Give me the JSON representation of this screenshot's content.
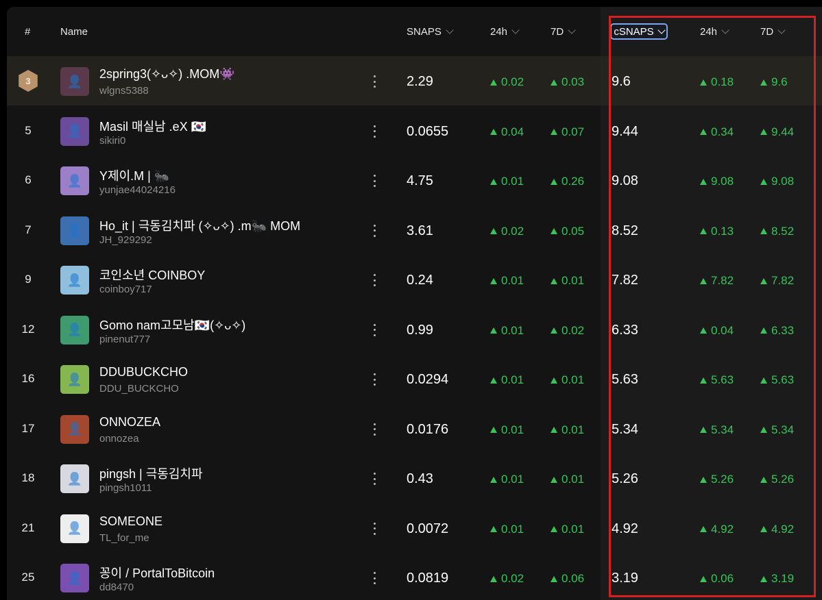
{
  "colors": {
    "up": "#3dc25b",
    "highlight_box": "#d4201f",
    "sort_outline": "#7fa4ea",
    "bronze": "#b8936c"
  },
  "header": {
    "rank": "#",
    "name": "Name",
    "snaps": "SNAPS",
    "snaps_24h": "24h",
    "snaps_7d": "7D",
    "csnaps": "cSNAPS",
    "csnaps_24h": "24h",
    "csnaps_7d": "7D"
  },
  "rows": [
    {
      "rank": "3",
      "badge": "bronze-medal",
      "name": "2spring3(✧ᴗ✧) .MOM👾",
      "handle": "wlgns5388",
      "snaps": "2.29",
      "s24h": "0.02",
      "s7d": "0.03",
      "csnaps": "9.6",
      "c24h": "0.18",
      "c7d": "9.6",
      "avatar_color": "#5a3a4a"
    },
    {
      "rank": "5",
      "name": "Masil 매실남 .eX 🇰🇷",
      "handle": "sikiri0",
      "snaps": "0.0655",
      "s24h": "0.04",
      "s7d": "0.07",
      "csnaps": "9.44",
      "c24h": "0.34",
      "c7d": "9.44",
      "avatar_color": "#6b4c9a"
    },
    {
      "rank": "6",
      "name": "Y제이.M | 🐜",
      "handle": "yunjae44024216",
      "snaps": "4.75",
      "s24h": "0.01",
      "s7d": "0.26",
      "csnaps": "9.08",
      "c24h": "9.08",
      "c7d": "9.08",
      "avatar_color": "#9b7fc9"
    },
    {
      "rank": "7",
      "name": "Ho_it | 극동김치파 (✧ᴗ✧) .m🐜 MOM",
      "handle": "JH_929292",
      "snaps": "3.61",
      "s24h": "0.02",
      "s7d": "0.05",
      "csnaps": "8.52",
      "c24h": "0.13",
      "c7d": "8.52",
      "avatar_color": "#3d6fb0"
    },
    {
      "rank": "9",
      "name": "코인소년 COINBOY",
      "handle": "coinboy717",
      "snaps": "0.24",
      "s24h": "0.01",
      "s7d": "0.01",
      "csnaps": "7.82",
      "c24h": "7.82",
      "c7d": "7.82",
      "avatar_color": "#8fbfdd"
    },
    {
      "rank": "12",
      "name": "Gomo nam고모남🇰🇷(✧ᴗ✧)",
      "handle": "pinenut777",
      "snaps": "0.99",
      "s24h": "0.01",
      "s7d": "0.02",
      "csnaps": "6.33",
      "c24h": "0.04",
      "c7d": "6.33",
      "avatar_color": "#3f9a6e"
    },
    {
      "rank": "16",
      "name": "DDUBUCKCHO",
      "handle": "DDU_BUCKCHO",
      "snaps": "0.0294",
      "s24h": "0.01",
      "s7d": "0.01",
      "csnaps": "5.63",
      "c24h": "5.63",
      "c7d": "5.63",
      "avatar_color": "#86b64f"
    },
    {
      "rank": "17",
      "name": "ONNOZEA",
      "handle": "onnozea",
      "snaps": "0.0176",
      "s24h": "0.01",
      "s7d": "0.01",
      "csnaps": "5.34",
      "c24h": "5.34",
      "c7d": "5.34",
      "avatar_color": "#a3472e"
    },
    {
      "rank": "18",
      "name": "pingsh | 극동김치파",
      "handle": "pingsh1011",
      "snaps": "0.43",
      "s24h": "0.01",
      "s7d": "0.01",
      "csnaps": "5.26",
      "c24h": "5.26",
      "c7d": "5.26",
      "avatar_color": "#d8d8e0"
    },
    {
      "rank": "21",
      "name": "SOMEONE",
      "handle": "TL_for_me",
      "snaps": "0.0072",
      "s24h": "0.01",
      "s7d": "0.01",
      "csnaps": "4.92",
      "c24h": "4.92",
      "c7d": "4.92",
      "avatar_color": "#eeeeee"
    },
    {
      "rank": "25",
      "name": "꽁이 / PortalToBitcoin",
      "handle": "dd8470",
      "snaps": "0.0819",
      "s24h": "0.02",
      "s7d": "0.06",
      "csnaps": "3.19",
      "c24h": "0.06",
      "c7d": "3.19",
      "avatar_color": "#7a4fb0"
    }
  ]
}
